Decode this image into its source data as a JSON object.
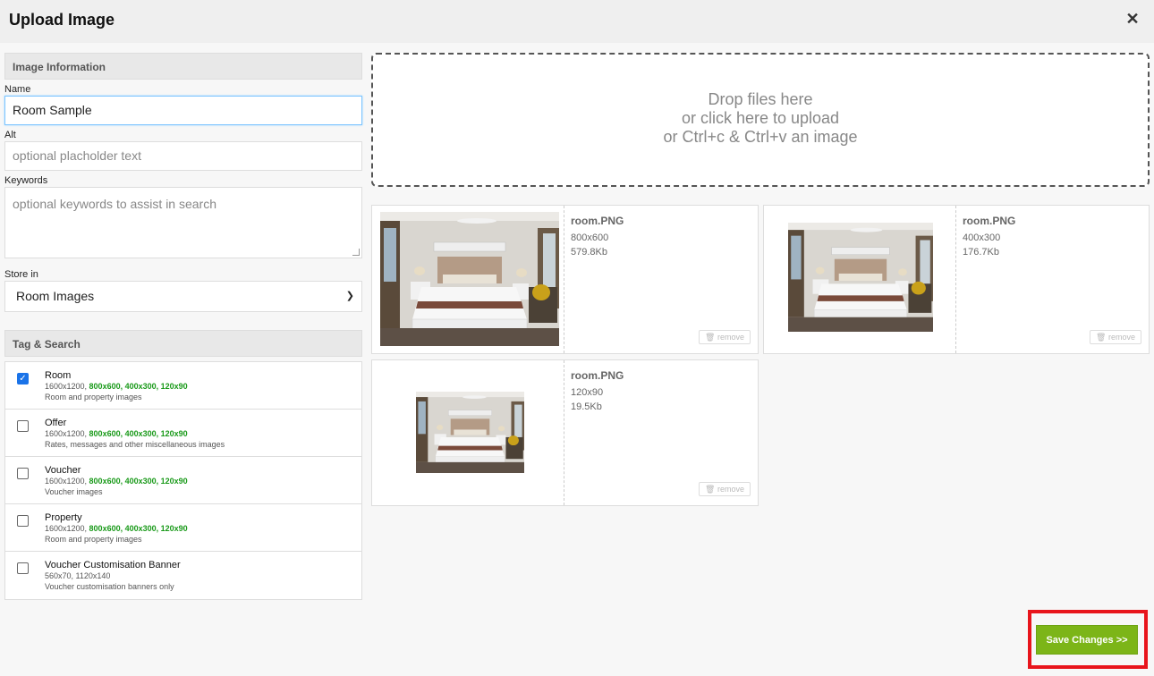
{
  "dialog": {
    "title": "Upload Image",
    "close_label": "✕"
  },
  "image_info": {
    "section_title": "Image Information",
    "name_label": "Name",
    "name_value": "Room Sample",
    "alt_label": "Alt",
    "alt_placeholder": "optional placholder text",
    "keywords_label": "Keywords",
    "keywords_placeholder": "optional keywords to assist in search",
    "store_label": "Store in",
    "store_value": "Room Images"
  },
  "tag_search": {
    "section_title": "Tag & Search",
    "items": [
      {
        "name": "Room",
        "sizes_plain": "1600x1200, ",
        "sizes_green": "800x600, 400x300, 120x90",
        "desc": "Room and property images",
        "checked": true
      },
      {
        "name": "Offer",
        "sizes_plain": "1600x1200, ",
        "sizes_green": "800x600, 400x300, 120x90",
        "desc": "Rates, messages and other miscellaneous images",
        "checked": false
      },
      {
        "name": "Voucher",
        "sizes_plain": "1600x1200, ",
        "sizes_green": "800x600, 400x300, 120x90",
        "desc": "Voucher images",
        "checked": false
      },
      {
        "name": "Property",
        "sizes_plain": "1600x1200, ",
        "sizes_green": "800x600, 400x300, 120x90",
        "desc": "Room and property images",
        "checked": false
      },
      {
        "name": "Voucher Customisation Banner",
        "sizes_plain": "560x70, 1120x140",
        "sizes_green": "",
        "desc": "Voucher customisation banners only",
        "checked": false
      }
    ]
  },
  "dropzone": {
    "line1": "Drop files here",
    "line2": "or click here to upload",
    "line3": "or Ctrl+c & Ctrl+v an image"
  },
  "files": [
    {
      "name": "room.PNG",
      "dims": "800x600",
      "size": "579.8Kb",
      "remove_label": "remove"
    },
    {
      "name": "room.PNG",
      "dims": "400x300",
      "size": "176.7Kb",
      "remove_label": "remove"
    },
    {
      "name": "room.PNG",
      "dims": "120x90",
      "size": "19.5Kb",
      "remove_label": "remove"
    }
  ],
  "footer": {
    "save_label": "Save Changes >>"
  },
  "colors": {
    "save_green": "#7cb518",
    "highlight_red": "#e8151c",
    "check_blue": "#1a73e8",
    "size_green": "#1a9a1a"
  }
}
